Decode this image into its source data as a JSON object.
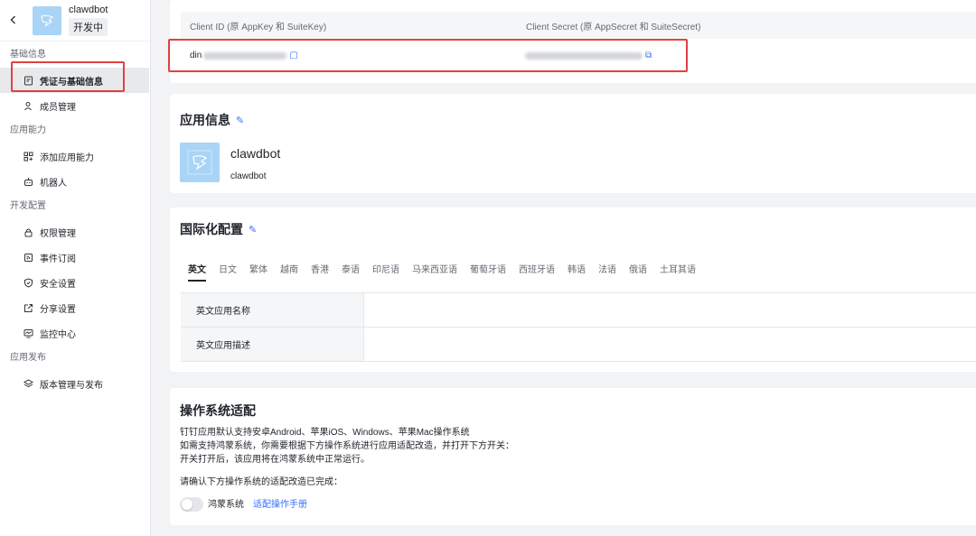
{
  "app": {
    "name": "clawdbot",
    "status": "开发中"
  },
  "sidebar": {
    "groups": [
      {
        "title": "基础信息",
        "items": [
          {
            "label": "凭证与基础信息",
            "icon": "credential-icon"
          },
          {
            "label": "成员管理",
            "icon": "member-icon"
          }
        ]
      },
      {
        "title": "应用能力",
        "items": [
          {
            "label": "添加应用能力",
            "icon": "add-capability-icon"
          },
          {
            "label": "机器人",
            "icon": "robot-icon"
          }
        ]
      },
      {
        "title": "开发配置",
        "items": [
          {
            "label": "权限管理",
            "icon": "lock-icon"
          },
          {
            "label": "事件订阅",
            "icon": "event-icon"
          },
          {
            "label": "安全设置",
            "icon": "shield-icon"
          },
          {
            "label": "分享设置",
            "icon": "share-icon"
          },
          {
            "label": "监控中心",
            "icon": "monitor-icon"
          }
        ]
      },
      {
        "title": "应用发布",
        "items": [
          {
            "label": "版本管理与发布",
            "icon": "layers-icon"
          }
        ]
      }
    ]
  },
  "credentials": {
    "client_id_header": "Client ID (原 AppKey 和 SuiteKey)",
    "client_secret_header": "Client Secret (原 AppSecret 和 SuiteSecret)",
    "client_id_prefix": "din"
  },
  "app_info": {
    "title": "应用信息",
    "name": "clawdbot",
    "desc": "clawdbot"
  },
  "i18n": {
    "title": "国际化配置",
    "tabs": [
      "英文",
      "日文",
      "繁体",
      "越南",
      "香港",
      "泰语",
      "印尼语",
      "马来西亚语",
      "葡萄牙语",
      "西班牙语",
      "韩语",
      "法语",
      "俄语",
      "土耳其语"
    ],
    "rows": [
      {
        "label": "英文应用名称",
        "value": ""
      },
      {
        "label": "英文应用描述",
        "value": ""
      }
    ]
  },
  "os": {
    "title": "操作系统适配",
    "line1": "钉钉应用默认支持安卓Android、苹果iOS、Windows、苹果Mac操作系统",
    "line2": "如需支持鸿蒙系统，你需要根据下方操作系统进行应用适配改造，并打开下方开关：",
    "line3": "开关打开后，该应用将在鸿蒙系统中正常运行。",
    "confirm": "请确认下方操作系统的适配改造已完成：",
    "harmony_label": "鸿蒙系统",
    "manual_link": "适配操作手册",
    "harmony_enabled": false
  },
  "colors": {
    "accent": "#3370ff",
    "highlight": "#e34040"
  }
}
